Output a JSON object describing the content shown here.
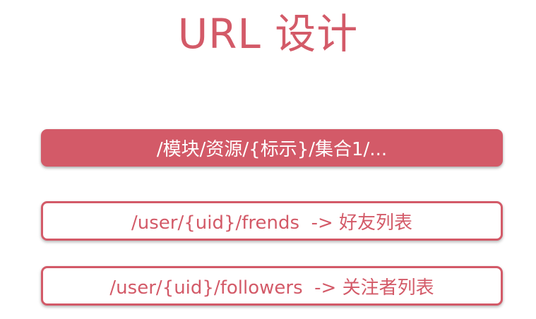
{
  "slide": {
    "title": "URL 设计",
    "pattern": "/模块/资源/{标示}/集合1/...",
    "examples": [
      {
        "text": "/user/{uid}/frends  -> 好友列表"
      },
      {
        "text": "/user/{uid}/followers  -> 关注者列表"
      }
    ]
  },
  "colors": {
    "accent": "#d35a68",
    "background": "#ffffff",
    "on_accent": "#ffffff"
  }
}
